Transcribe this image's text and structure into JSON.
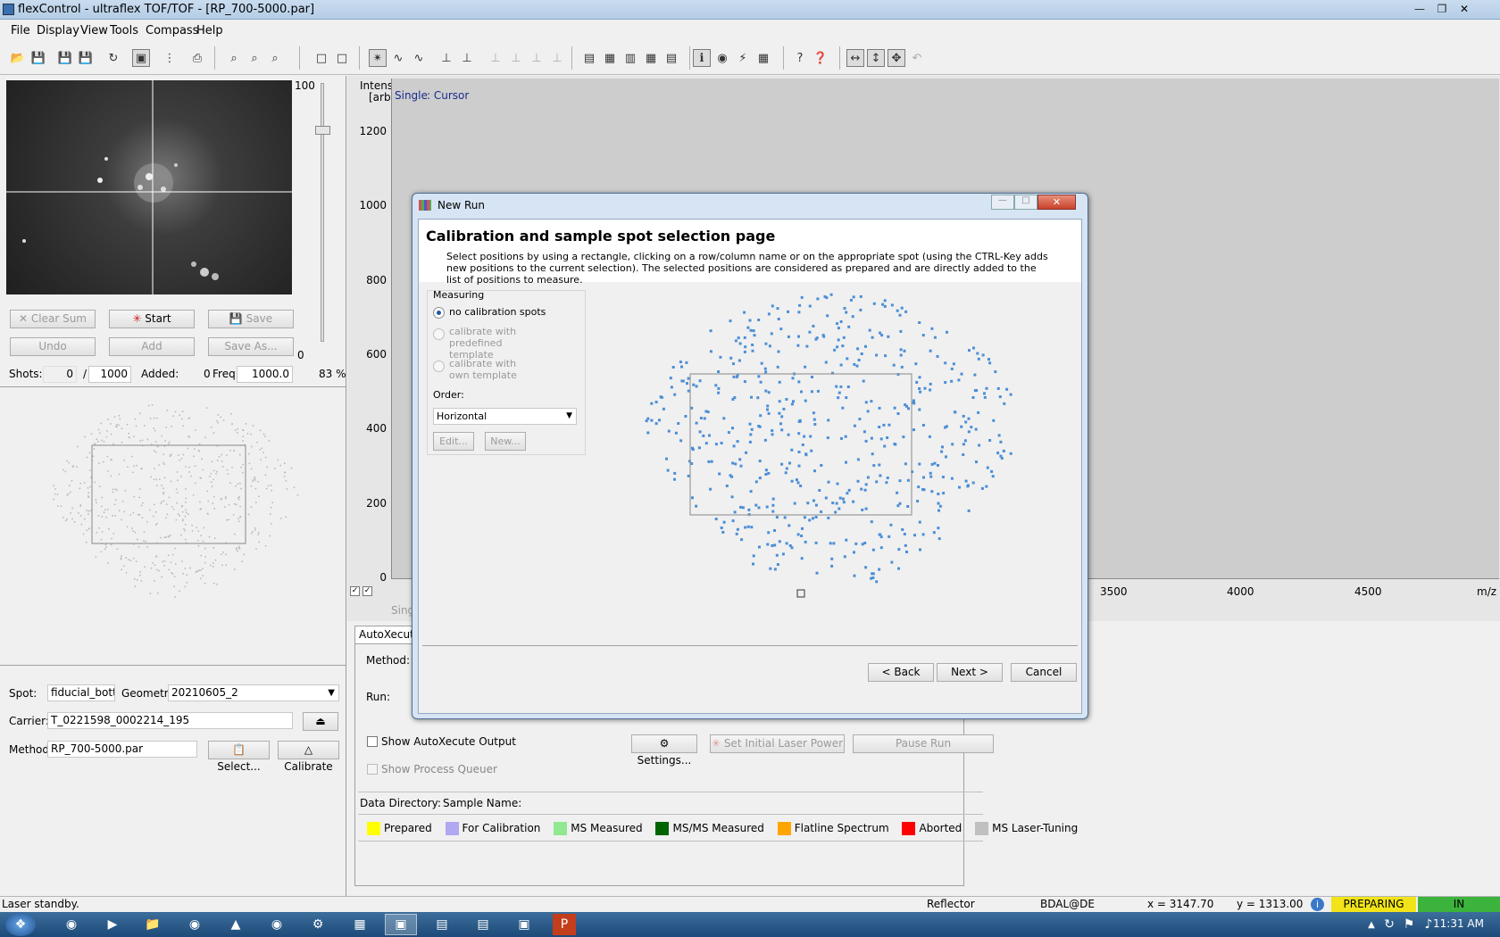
{
  "window": {
    "title": "flexControl - ultraflex TOF/TOF - [RP_700-5000.par]"
  },
  "menu": [
    "File",
    "Display",
    "View",
    "Tools",
    "Compass",
    "Help"
  ],
  "camera": {
    "slider_max": "100",
    "slider_min": "0"
  },
  "acq_buttons": {
    "clear_sum": "Clear Sum",
    "start": "Start",
    "save": "Save",
    "undo": "Undo",
    "add": "Add",
    "save_as": "Save As..."
  },
  "shots": {
    "label": "Shots:",
    "value": "0",
    "sep": "/",
    "total": "1000",
    "added_label": "Added:",
    "added": "0",
    "freq_label": "Freq:",
    "freq": "1000.0",
    "percent": "83 %"
  },
  "spot": {
    "label": "Spot:",
    "value": "fiducial_bottom",
    "geometry_label": "Geometry:",
    "geometry": "20210605_2"
  },
  "carrier": {
    "label": "Carrier:",
    "value": "T_0221598_0002214_195"
  },
  "method": {
    "label": "Method:",
    "value": "RP_700-5000.par",
    "select": "Select...",
    "calibrate": "Calibrate"
  },
  "spectrum": {
    "ylabel": "Intens.",
    "yunit": "[arb]",
    "mode": "Single",
    "cursor": ": Cursor",
    "yticks": [
      "1200",
      "1000",
      "800",
      "600",
      "400",
      "200",
      "0"
    ],
    "xticks": [
      "3500",
      "4000",
      "4500"
    ],
    "xunit": "m/z",
    "bottom_trunc": "Sing"
  },
  "autox": {
    "tab": "AutoXecute",
    "method_label": "Method:",
    "run_label": "Run:",
    "show_output": "Show AutoXecute Output",
    "show_queue": "Show Process Queuer",
    "settings": "Settings...",
    "laser_power": "Set Initial Laser Power",
    "pause": "Pause Run",
    "data_dir": "Data Directory:",
    "sample_name": "Sample Name:"
  },
  "legend": [
    {
      "label": "Prepared",
      "color": "#ffff00"
    },
    {
      "label": "For Calibration",
      "color": "#b0a8f0"
    },
    {
      "label": "MS Measured",
      "color": "#90e890"
    },
    {
      "label": "MS/MS Measured",
      "color": "#006400"
    },
    {
      "label": "Flatline Spectrum",
      "color": "#ffa500"
    },
    {
      "label": "Aborted",
      "color": "#ff0000"
    },
    {
      "label": "MS Laser-Tuning",
      "color": "#c0c0c0"
    }
  ],
  "dialog": {
    "title": "New Run",
    "heading": "Calibration and sample spot selection page",
    "description": "Select positions by using a rectangle, clicking on a row/column name or on the appropriate spot (using the CTRL-Key adds new positions to the current selection). The selected positions are considered as prepared and are directly added to the list of positions to measure.",
    "measuring": "Measuring",
    "opt1": "no calibration spots",
    "opt2": "calibrate with predefined template",
    "opt3": "calibrate with own template",
    "order_label": "Order:",
    "order": "Horizontal",
    "edit": "Edit...",
    "new": "New...",
    "back": "< Back",
    "next": "Next >",
    "cancel": "Cancel"
  },
  "status": {
    "left": "Laser standby.",
    "mode": "Reflector",
    "user": "BDAL@DE",
    "x": "x = 3147.70",
    "y": "y = 1313.00",
    "state": "PREPARING",
    "in": "IN"
  },
  "clock": "11:31 AM",
  "icons": [
    "open-icon",
    "save-icon",
    "refresh-icon",
    "print-icon",
    "zoom-icon",
    "help-icon"
  ]
}
